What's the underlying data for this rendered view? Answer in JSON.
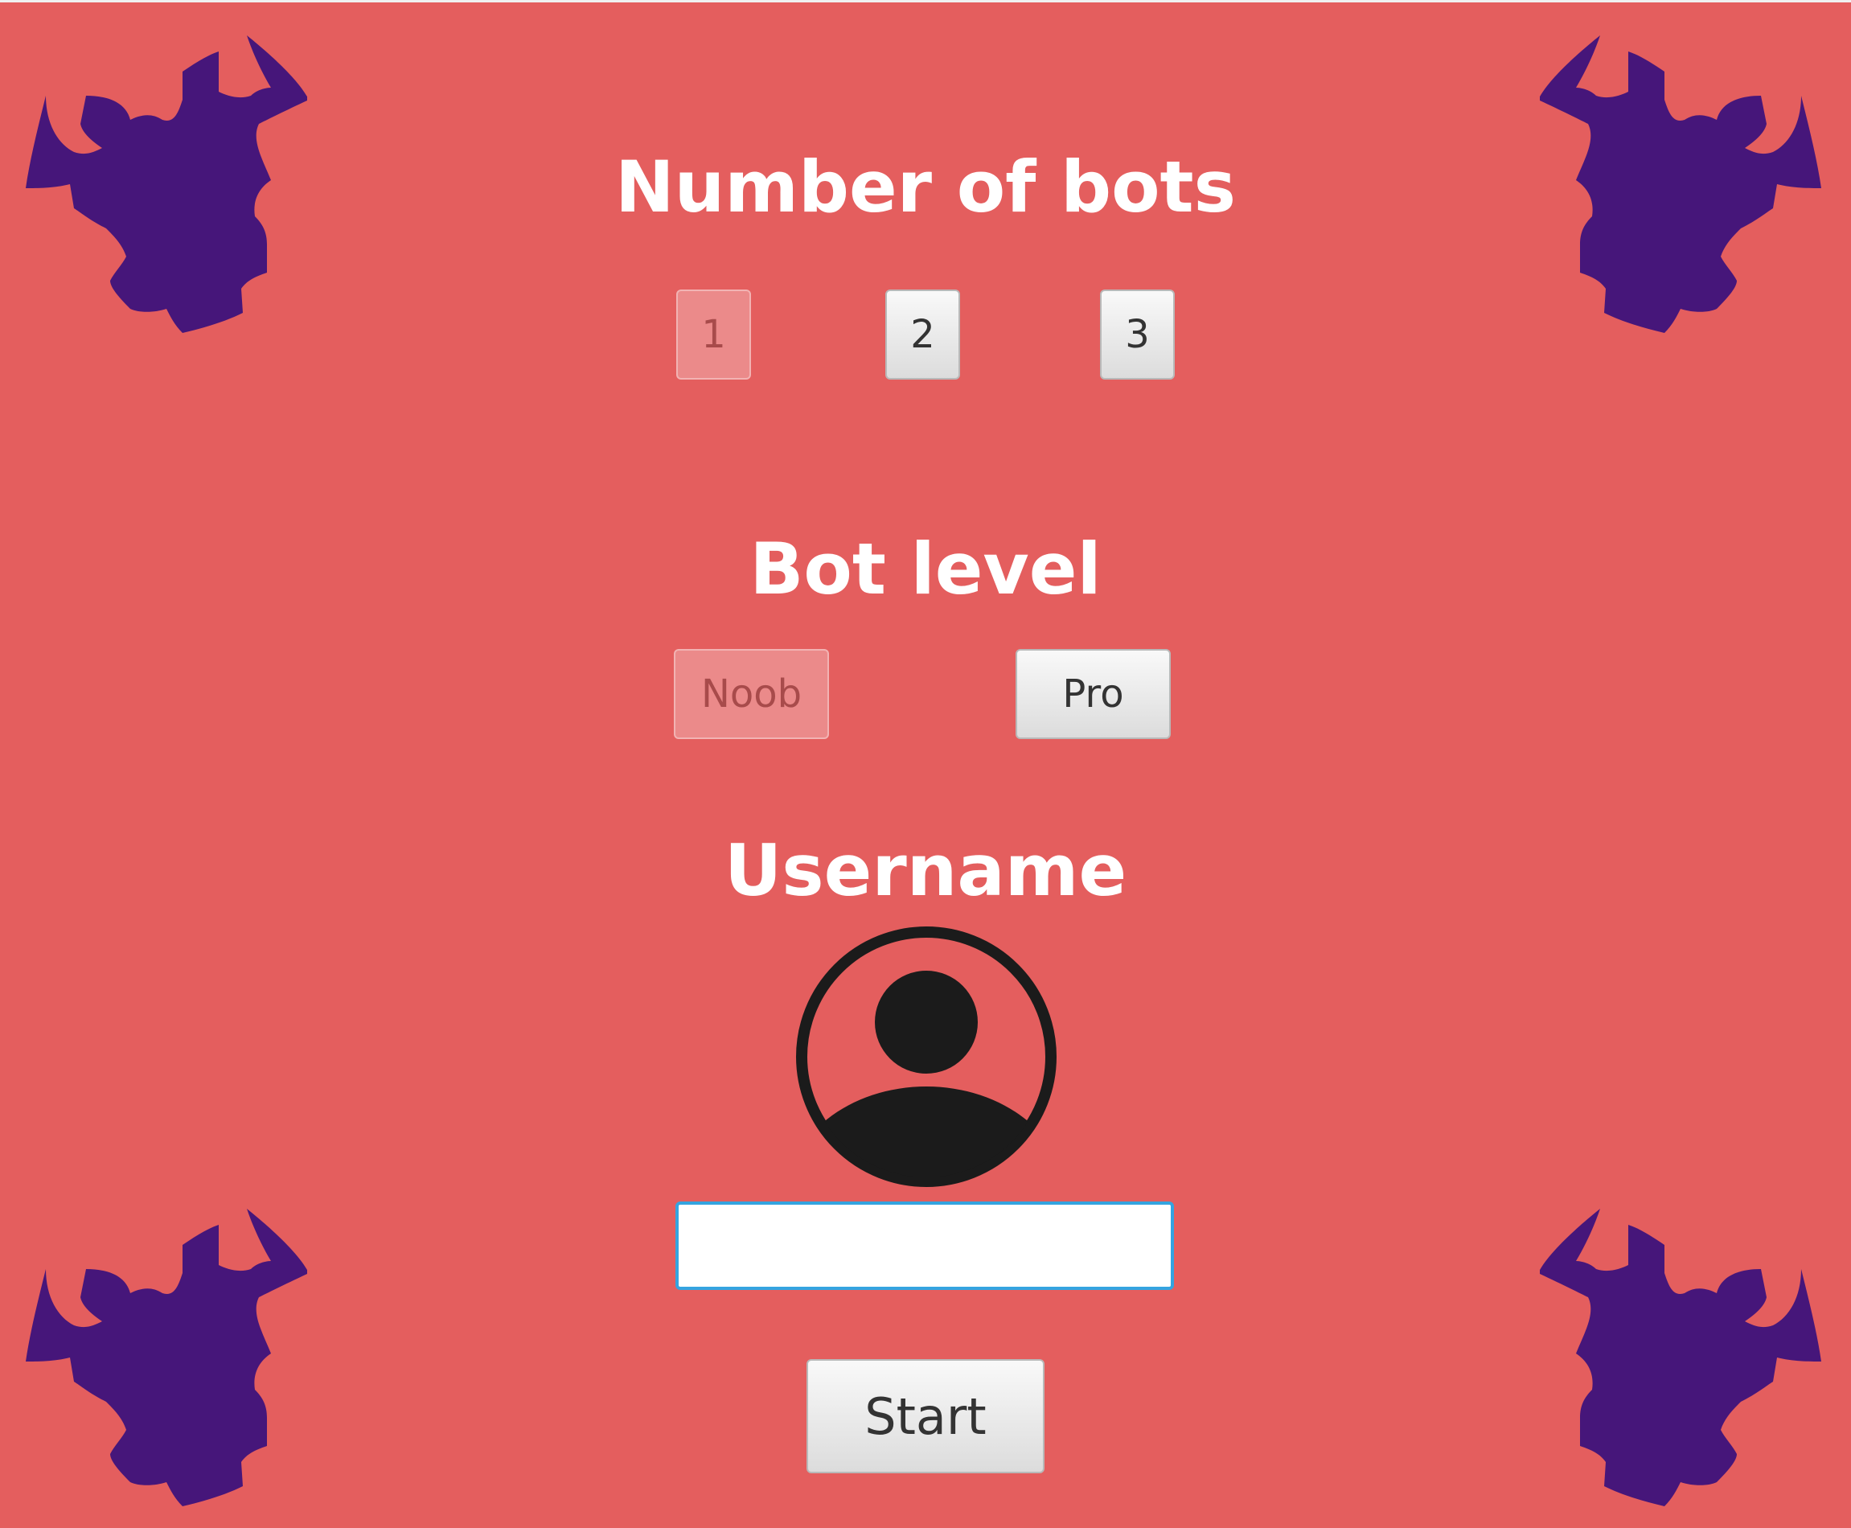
{
  "colors": {
    "background": "#e45e5e",
    "emblem": "#46167a",
    "heading_text": "#ffffff",
    "focus_border": "#34a4e0"
  },
  "bots": {
    "title": "Number of bots",
    "options": [
      "1",
      "2",
      "3"
    ],
    "selected": "1"
  },
  "level": {
    "title": "Bot level",
    "options": [
      "Noob",
      "Pro"
    ],
    "selected": "Noob"
  },
  "user": {
    "title": "Username",
    "avatar_icon": "user-circle-icon",
    "input_value": "",
    "input_placeholder": ""
  },
  "start": {
    "label": "Start"
  },
  "decorations": {
    "corner_icon": "horned-demon-emblem-icon"
  }
}
